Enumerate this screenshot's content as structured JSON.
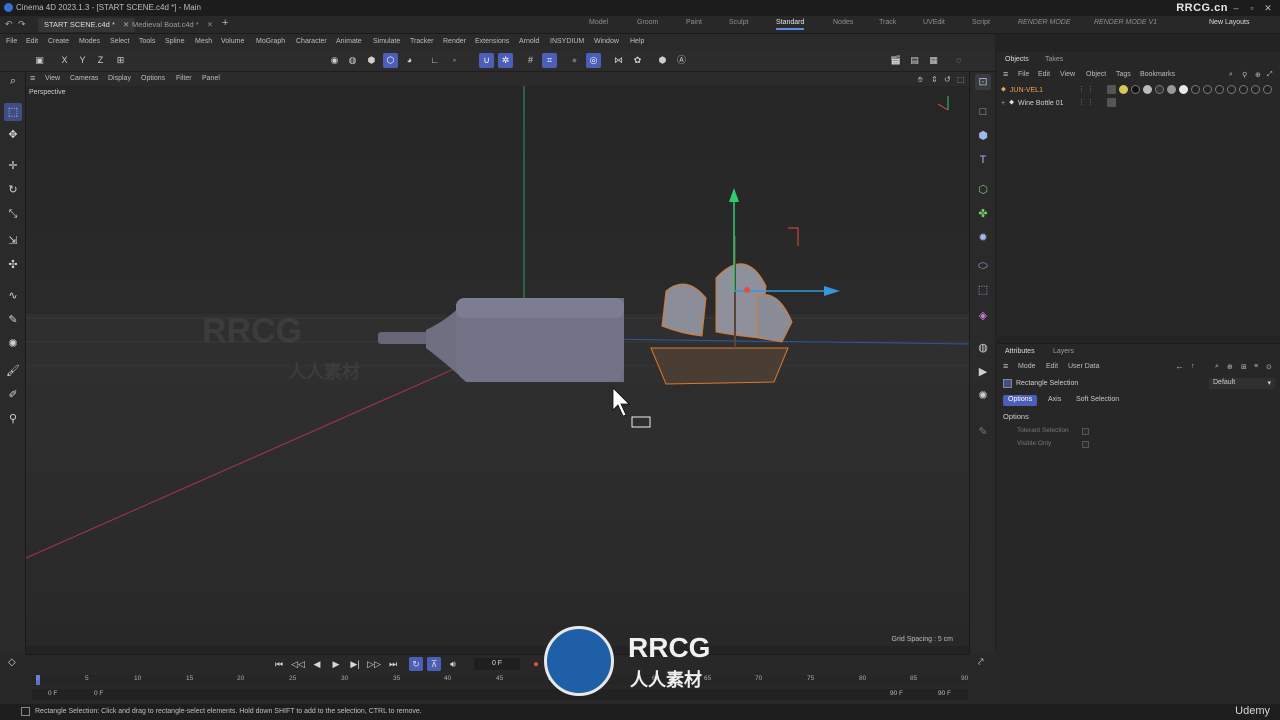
{
  "window": {
    "title": "Cinema 4D 2023.1.3 - [START SCENE.c4d *] - Main"
  },
  "tabs": {
    "documents": [
      "START SCENE.c4d *",
      "Medieval Boat.c4d *"
    ],
    "layouts": [
      "Model",
      "Groom",
      "Paint",
      "Sculpt",
      "Standard",
      "Nodes",
      "Track",
      "UVEdit",
      "Script",
      "RENDER MODE",
      "RENDER MODE V1"
    ],
    "active_layout": "Standard",
    "new_layouts": "New Layouts"
  },
  "menubar": [
    "File",
    "Edit",
    "Create",
    "Modes",
    "Select",
    "Tools",
    "Spline",
    "Mesh",
    "Volume",
    "MoGraph",
    "Character",
    "Animate",
    "Simulate",
    "Tracker",
    "Render",
    "Extensions",
    "Arnold",
    "INSYDIUM",
    "Window",
    "Help"
  ],
  "axis_lock": {
    "x": "X",
    "y": "Y",
    "z": "Z"
  },
  "viewport_menu": [
    "View",
    "Cameras",
    "Display",
    "Options",
    "Filter",
    "Panel"
  ],
  "viewport": {
    "label": "Perspective",
    "grid_spacing": "Grid Spacing : 5 cm"
  },
  "objects_panel": {
    "tabs": [
      "Objects",
      "Takes"
    ],
    "menu": [
      "File",
      "Edit",
      "View",
      "Object",
      "Tags",
      "Bookmarks"
    ],
    "items": [
      {
        "name": "JUN-VEL1",
        "selected": true
      },
      {
        "name": "Wine Bottle 01",
        "selected": false
      }
    ]
  },
  "attributes_panel": {
    "tabs": [
      "Attributes",
      "Layers"
    ],
    "menu": [
      "Mode",
      "Edit",
      "User Data"
    ],
    "tool_name": "Rectangle Selection",
    "preset": "Default",
    "subtabs": [
      "Options",
      "Axis",
      "Soft Selection"
    ],
    "section": "Options",
    "options": [
      "Tolerant Selection",
      "Visible Only"
    ]
  },
  "timeline": {
    "current_frame": "0 F",
    "ticks": [
      "0",
      "5",
      "10",
      "15",
      "20",
      "25",
      "30",
      "35",
      "40",
      "45",
      "50",
      "55",
      "60",
      "65",
      "70",
      "75",
      "80",
      "85",
      "90"
    ],
    "range_start": "0 F",
    "range_start2": "0 F",
    "range_end": "90 F",
    "range_end2": "90 F"
  },
  "statusbar": {
    "text": "Rectangle Selection: Click and drag to rectangle-select elements. Hold down SHIFT to add to the selection, CTRL to remove."
  },
  "watermarks": {
    "site": "RRCG.cn",
    "brand": "RRCG",
    "brand_sub": "人人素材",
    "course": "Udemy"
  },
  "colors": {
    "accent": "#5a8dee",
    "selected_object": "#f0a35a",
    "y_axis": "#2ecc71",
    "x_axis": "#e74c3c",
    "z_axis": "#3498db"
  }
}
